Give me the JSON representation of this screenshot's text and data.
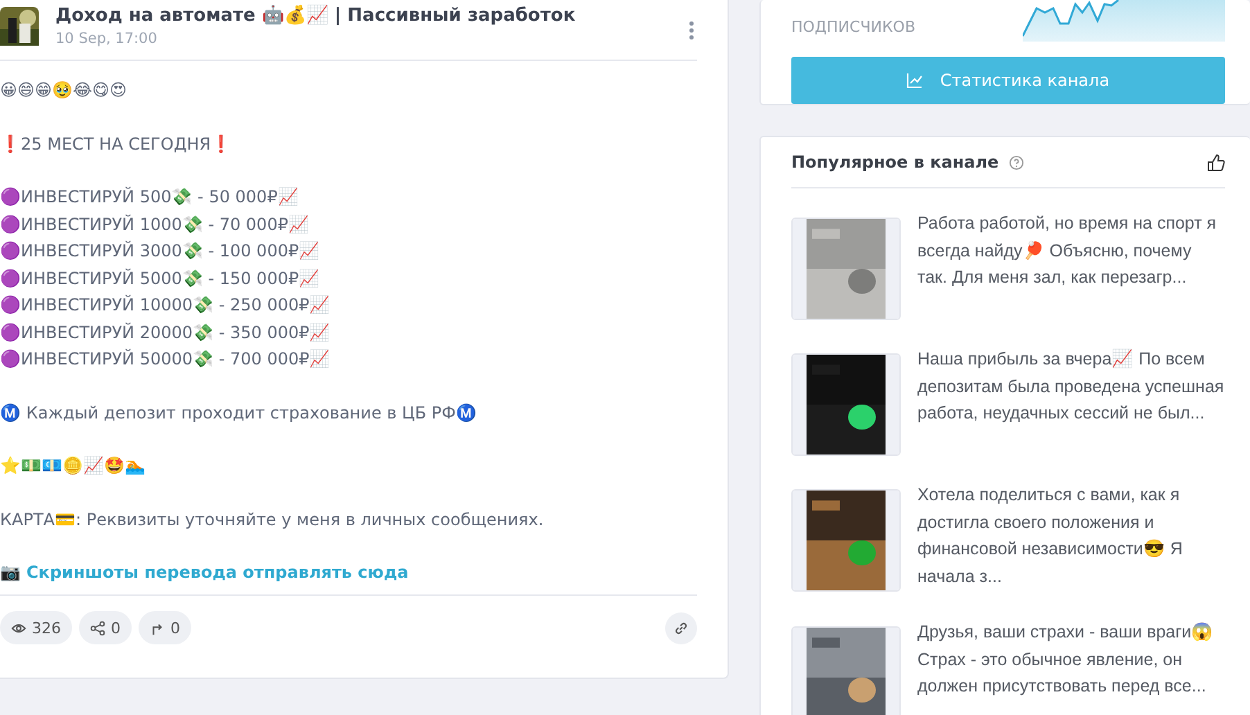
{
  "post": {
    "channel": "Доход на автомате 🤖💰📈 | Пассивный заработок",
    "date": "10 Sep, 17:00",
    "paragraphs": [
      [
        {
          "kind": "text",
          "text": "😀😄😁🥹😂😋😍"
        }
      ],
      [
        {
          "kind": "text",
          "text": "❗25 МЕСТ НА СЕГОДНЯ❗"
        }
      ],
      [
        {
          "kind": "text",
          "text": "🟣ИНВЕСТИРУЙ 500💸 - 50 000₽📈"
        },
        {
          "kind": "text",
          "text": "🟣ИНВЕСТИРУЙ 1000💸 - 70 000₽📈"
        },
        {
          "kind": "text",
          "text": "🟣ИНВЕСТИРУЙ 3000💸 - 100 000₽📈"
        },
        {
          "kind": "text",
          "text": "🟣ИНВЕСТИРУЙ 5000💸 - 150 000₽📈"
        },
        {
          "kind": "text",
          "text": "🟣ИНВЕСТИРУЙ 10000💸 - 250 000₽📈"
        },
        {
          "kind": "text",
          "text": "🟣ИНВЕСТИРУЙ 20000💸 - 350 000₽📈"
        },
        {
          "kind": "text",
          "text": "🟣ИНВЕСТИРУЙ 50000💸 - 700 000₽📈"
        }
      ],
      [
        {
          "kind": "text",
          "text": "Ⓜ️ Каждый депозит проходит страхование в ЦБ РФⓂ️"
        }
      ],
      [
        {
          "kind": "text",
          "text": "⭐💵💶🪙📈🤩🏊"
        }
      ],
      [
        {
          "kind": "text",
          "text": "КАРТА💳: Реквизиты уточняйте у меня в личных сообщениях."
        }
      ],
      [
        {
          "kind": "link",
          "icon": "📷",
          "text": "Скриншоты перевода отправлять сюда"
        }
      ]
    ],
    "stats": [
      {
        "kind": "views",
        "value": "326"
      },
      {
        "kind": "shares",
        "value": "0"
      },
      {
        "kind": "forwards",
        "value": "0"
      }
    ]
  },
  "channel_card": {
    "subscribers_label": "ПОДПИСЧИКОВ",
    "stats_button": "Статистика канала"
  },
  "popular": {
    "title": "Популярное в канале",
    "items": [
      {
        "text": "Работа работой, но время на спорт я всегда найду🏓 Объясню, почему так. Для меня зал, как перезагр..."
      },
      {
        "text": "Наша прибыль за вчера📈 По всем депозитам была проведена успешная работа, неудачных сессий не был..."
      },
      {
        "text": "Хотела поделиться с вами, как я достигла своего положения и финансовой независимости😎 Я начала з..."
      },
      {
        "text": "Друзья, ваши страхи - ваши враги😱 Страх - это обычное явление, он должен присутствовать перед все..."
      }
    ]
  }
}
